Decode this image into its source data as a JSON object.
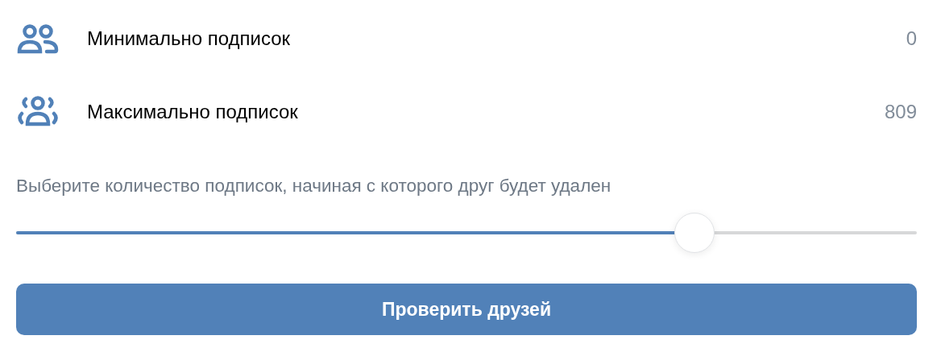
{
  "stats": [
    {
      "kind": "min",
      "label": "Минимально подписок",
      "value": "0"
    },
    {
      "kind": "max",
      "label": "Максимально подписок",
      "value": "809"
    }
  ],
  "slider": {
    "caption": "Выберите количество подписок, начиная с которого друг будет удален",
    "level": 0.753
  },
  "button": {
    "label": "Проверить друзей"
  }
}
